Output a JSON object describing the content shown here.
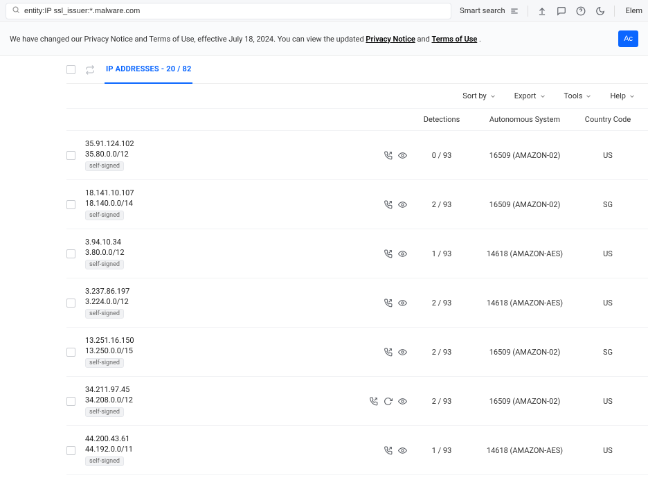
{
  "search": {
    "query": "entity:IP ssl_issuer:*.malware.com",
    "smart_search_label": "Smart search",
    "elem_label": "Elem"
  },
  "notice": {
    "prefix": "We have changed our Privacy Notice and Terms of Use, effective July 18, 2024. You can view the updated ",
    "privacy_link": "Privacy Notice",
    "and": " and ",
    "terms_link": "Terms of Use",
    "suffix": ".",
    "button": "Ac"
  },
  "tabs": {
    "main": "IP ADDRESSES - 20 / 82"
  },
  "toolbar": {
    "sort": "Sort by",
    "export": "Export",
    "tools": "Tools",
    "help": "Help"
  },
  "columns": {
    "detections": "Detections",
    "as": "Autonomous System",
    "cc": "Country Code"
  },
  "rows": [
    {
      "ip": "35.91.124.102",
      "cidr": "35.80.0.0/12",
      "tag": "self-signed",
      "extra_icon": false,
      "detections": "0  / 93",
      "as": "16509 (AMAZON-02)",
      "cc": "US"
    },
    {
      "ip": "18.141.10.107",
      "cidr": "18.140.0.0/14",
      "tag": "self-signed",
      "extra_icon": false,
      "detections": "2  / 93",
      "as": "16509 (AMAZON-02)",
      "cc": "SG"
    },
    {
      "ip": "3.94.10.34",
      "cidr": "3.80.0.0/12",
      "tag": "self-signed",
      "extra_icon": false,
      "detections": "1  / 93",
      "as": "14618 (AMAZON-AES)",
      "cc": "US"
    },
    {
      "ip": "3.237.86.197",
      "cidr": "3.224.0.0/12",
      "tag": "self-signed",
      "extra_icon": false,
      "detections": "2  / 93",
      "as": "14618 (AMAZON-AES)",
      "cc": "US"
    },
    {
      "ip": "13.251.16.150",
      "cidr": "13.250.0.0/15",
      "tag": "self-signed",
      "extra_icon": false,
      "detections": "2  / 93",
      "as": "16509 (AMAZON-02)",
      "cc": "SG"
    },
    {
      "ip": "34.211.97.45",
      "cidr": "34.208.0.0/12",
      "tag": "self-signed",
      "extra_icon": true,
      "detections": "2  / 93",
      "as": "16509 (AMAZON-02)",
      "cc": "US"
    },
    {
      "ip": "44.200.43.61",
      "cidr": "44.192.0.0/11",
      "tag": "self-signed",
      "extra_icon": false,
      "detections": "1  / 93",
      "as": "14618 (AMAZON-AES)",
      "cc": "US"
    }
  ]
}
